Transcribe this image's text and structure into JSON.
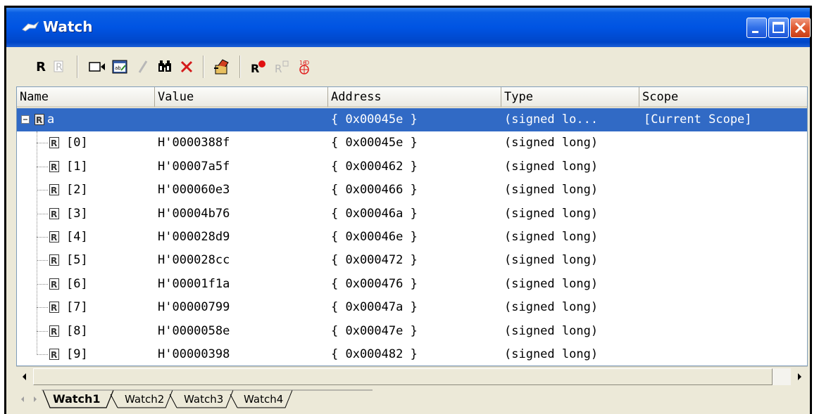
{
  "window": {
    "title": "Watch"
  },
  "columns": [
    "Name",
    "Value",
    "Address",
    "Type",
    "Scope"
  ],
  "rows": [
    {
      "name": "a",
      "value": "",
      "address": "{ 0x00045e }",
      "type": "(signed lo...",
      "scope": "[Current Scope]",
      "selected": true
    },
    {
      "name": "[0]",
      "value": "H'0000388f",
      "address": "{ 0x00045e }",
      "type": "(signed long)",
      "scope": ""
    },
    {
      "name": "[1]",
      "value": "H'00007a5f",
      "address": "{ 0x000462 }",
      "type": "(signed long)",
      "scope": ""
    },
    {
      "name": "[2]",
      "value": "H'000060e3",
      "address": "{ 0x000466 }",
      "type": "(signed long)",
      "scope": ""
    },
    {
      "name": "[3]",
      "value": "H'00004b76",
      "address": "{ 0x00046a }",
      "type": "(signed long)",
      "scope": ""
    },
    {
      "name": "[4]",
      "value": "H'000028d9",
      "address": "{ 0x00046e }",
      "type": "(signed long)",
      "scope": ""
    },
    {
      "name": "[5]",
      "value": "H'000028cc",
      "address": "{ 0x000472 }",
      "type": "(signed long)",
      "scope": ""
    },
    {
      "name": "[6]",
      "value": "H'00001f1a",
      "address": "{ 0x000476 }",
      "type": "(signed long)",
      "scope": ""
    },
    {
      "name": "[7]",
      "value": "H'00000799",
      "address": "{ 0x00047a }",
      "type": "(signed long)",
      "scope": ""
    },
    {
      "name": "[8]",
      "value": "H'0000058e",
      "address": "{ 0x00047e }",
      "type": "(signed long)",
      "scope": ""
    },
    {
      "name": "[9]",
      "value": "H'00000398",
      "address": "{ 0x000482 }",
      "type": "(signed long)",
      "scope": ""
    }
  ],
  "tabs": [
    "Watch1",
    "Watch2",
    "Watch3",
    "Watch4"
  ],
  "active_tab": "Watch1",
  "toolbar": {
    "icons": [
      "radix-icon",
      "radix-disabled-icon",
      "add-watch-icon",
      "edit-value-icon",
      "edit-disabled-icon",
      "find-icon",
      "delete-icon",
      "refresh-icon",
      "record-icon",
      "record-disabled-icon",
      "format-icon"
    ]
  },
  "colors": {
    "selection": "#316ac5",
    "title_bar": "#0054e3",
    "window_bg": "#ece9d8"
  }
}
